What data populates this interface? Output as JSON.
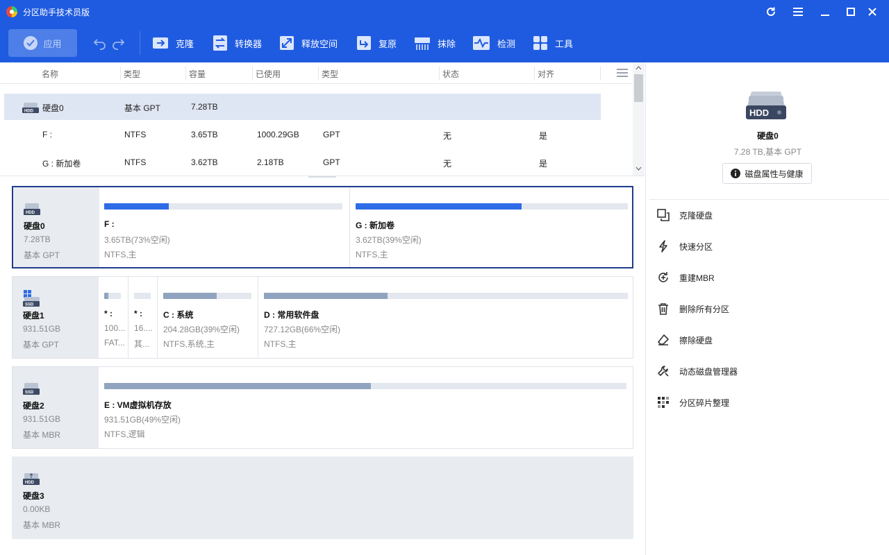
{
  "app": {
    "title": "分区助手技术员版"
  },
  "toolbar": {
    "apply": "应用",
    "tools": [
      {
        "label": "克隆",
        "icon": "clone-icon"
      },
      {
        "label": "转换器",
        "icon": "converter-icon"
      },
      {
        "label": "释放空间",
        "icon": "free-space-icon"
      },
      {
        "label": "复原",
        "icon": "restore-icon"
      },
      {
        "label": "抹除",
        "icon": "wipe-icon"
      },
      {
        "label": "检测",
        "icon": "check-icon"
      },
      {
        "label": "工具",
        "icon": "tools-icon"
      }
    ]
  },
  "list": {
    "columns": [
      "名称",
      "类型",
      "容量",
      "已使用",
      "类型",
      "状态",
      "对齐"
    ],
    "rows": [
      {
        "name": "硬盘0",
        "type": "基本 GPT",
        "capacity": "7.28TB",
        "used": "",
        "fstype": "",
        "status": "",
        "align": ""
      },
      {
        "name": "F :",
        "type": "NTFS",
        "capacity": "3.65TB",
        "used": "1000.29GB",
        "fstype": "GPT",
        "status": "无",
        "align": "是"
      },
      {
        "name": "G : 新加卷",
        "type": "NTFS",
        "capacity": "3.62TB",
        "used": "2.18TB",
        "fstype": "GPT",
        "status": "无",
        "align": "是"
      }
    ]
  },
  "disks": [
    {
      "name": "硬盘0",
      "size": "7.28TB",
      "type": "基本 GPT",
      "partitions": [
        {
          "name": "F :",
          "info1": "3.65TB(73%空闲)",
          "info2": "NTFS,主",
          "used": 0.27
        },
        {
          "name": "G : 新加卷",
          "info1": "3.62TB(39%空闲)",
          "info2": "NTFS,主",
          "used": 0.61
        }
      ]
    },
    {
      "name": "硬盘1",
      "size": "931.51GB",
      "type": "基本 GPT",
      "partitions": [
        {
          "name": "* :",
          "info1": "100...",
          "info2": "FAT...",
          "used": 0.25
        },
        {
          "name": "* :",
          "info1": "16....",
          "info2": "其...",
          "used": 0.0
        },
        {
          "name": "C : 系统",
          "info1": "204.28GB(39%空闲)",
          "info2": "NTFS,系统,主",
          "used": 0.61
        },
        {
          "name": "D : 常用软件盘",
          "info1": "727.12GB(66%空闲)",
          "info2": "NTFS,主",
          "used": 0.34
        }
      ]
    },
    {
      "name": "硬盘2",
      "size": "931.51GB",
      "type": "基本 MBR",
      "partitions": [
        {
          "name": "E : VM虚拟机存放",
          "info1": "931.51GB(49%空闲)",
          "info2": "NTFS,逻辑",
          "used": 0.51
        }
      ]
    },
    {
      "name": "硬盘3",
      "size": "0.00KB",
      "type": "基本 MBR",
      "partitions": []
    }
  ],
  "right": {
    "badge": "HDD",
    "disk_name": "硬盘0",
    "disk_info": "7.28 TB,基本 GPT",
    "props_button": "磁盘属性与健康",
    "actions": [
      {
        "label": "克隆硬盘",
        "icon": "clone-disk-icon"
      },
      {
        "label": "快速分区",
        "icon": "lightning-icon"
      },
      {
        "label": "重建MBR",
        "icon": "rebuild-mbr-icon"
      },
      {
        "label": "删除所有分区",
        "icon": "trash-icon"
      },
      {
        "label": "擦除硬盘",
        "icon": "eraser-icon"
      },
      {
        "label": "动态磁盘管理器",
        "icon": "wrench-icon"
      },
      {
        "label": "分区碎片整理",
        "icon": "defrag-icon"
      }
    ]
  },
  "colors": {
    "brand": "#1f5be0",
    "used_blue": "#2e6be6",
    "used_gray": "#90a4c0"
  }
}
